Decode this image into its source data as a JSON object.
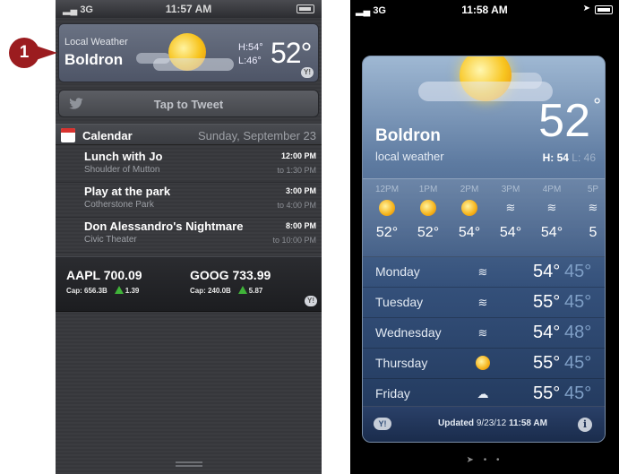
{
  "step_marker": "1",
  "left": {
    "status": {
      "signal": "3G",
      "time": "11:57 AM"
    },
    "weather": {
      "source": "Local Weather",
      "city": "Boldron",
      "hi": "H:54°",
      "lo": "L:46°",
      "temp": "52°",
      "yahoo": "Y!"
    },
    "tweet": {
      "label": "Tap to Tweet"
    },
    "calendar": {
      "title": "Calendar",
      "date": "Sunday, September 23",
      "events": [
        {
          "title": "Lunch with Jo",
          "location": "Shoulder of Mutton",
          "start": "12:00 PM",
          "end": "to 1:30 PM"
        },
        {
          "title": "Play at the park",
          "location": "Cotherstone Park",
          "start": "3:00 PM",
          "end": "to 4:00 PM"
        },
        {
          "title": "Don Alessandro's Nightmare",
          "location": "Civic Theater",
          "start": "8:00 PM",
          "end": "to 10:00 PM"
        }
      ]
    },
    "stocks": [
      {
        "name": "AAPL 700.09",
        "cap": "Cap: 656.3B",
        "change": "1.39"
      },
      {
        "name": "GOOG 733.99",
        "cap": "Cap: 240.0B",
        "change": "5.87"
      }
    ],
    "stocks_yahoo": "Y!"
  },
  "right": {
    "status": {
      "signal": "3G",
      "time": "11:58 AM"
    },
    "weather": {
      "city": "Boldron",
      "subtitle": "local weather",
      "temp": "52",
      "hi": "H: 54",
      "lo": "L: 46",
      "hourly": [
        {
          "label": "12PM",
          "icon": "sun-cloud-icon",
          "temp": "52°"
        },
        {
          "label": "1PM",
          "icon": "sun-cloud-icon",
          "temp": "52°"
        },
        {
          "label": "2PM",
          "icon": "sun-cloud-icon",
          "temp": "54°"
        },
        {
          "label": "3PM",
          "icon": "wind-icon",
          "temp": "54°"
        },
        {
          "label": "4PM",
          "icon": "wind-icon",
          "temp": "54°"
        },
        {
          "label": "5P",
          "icon": "wind-icon",
          "temp": "5"
        }
      ],
      "forecast": [
        {
          "day": "Monday",
          "icon": "wind-icon",
          "hi": "54°",
          "lo": "45°"
        },
        {
          "day": "Tuesday",
          "icon": "wind-icon",
          "hi": "55°",
          "lo": "45°"
        },
        {
          "day": "Wednesday",
          "icon": "wind-icon",
          "hi": "54°",
          "lo": "48°"
        },
        {
          "day": "Thursday",
          "icon": "sun-icon",
          "hi": "55°",
          "lo": "45°"
        },
        {
          "day": "Friday",
          "icon": "cloud-wind-icon",
          "hi": "55°",
          "lo": "45°"
        }
      ],
      "footer": {
        "updated_label": "Updated",
        "updated_date": "9/23/12",
        "updated_time": "11:58 AM",
        "yahoo": "Y!",
        "info": "i"
      }
    }
  },
  "colors": {
    "marker": "#9b1c1f",
    "stock_up": "#40b339",
    "weather_card": "#34507a"
  }
}
